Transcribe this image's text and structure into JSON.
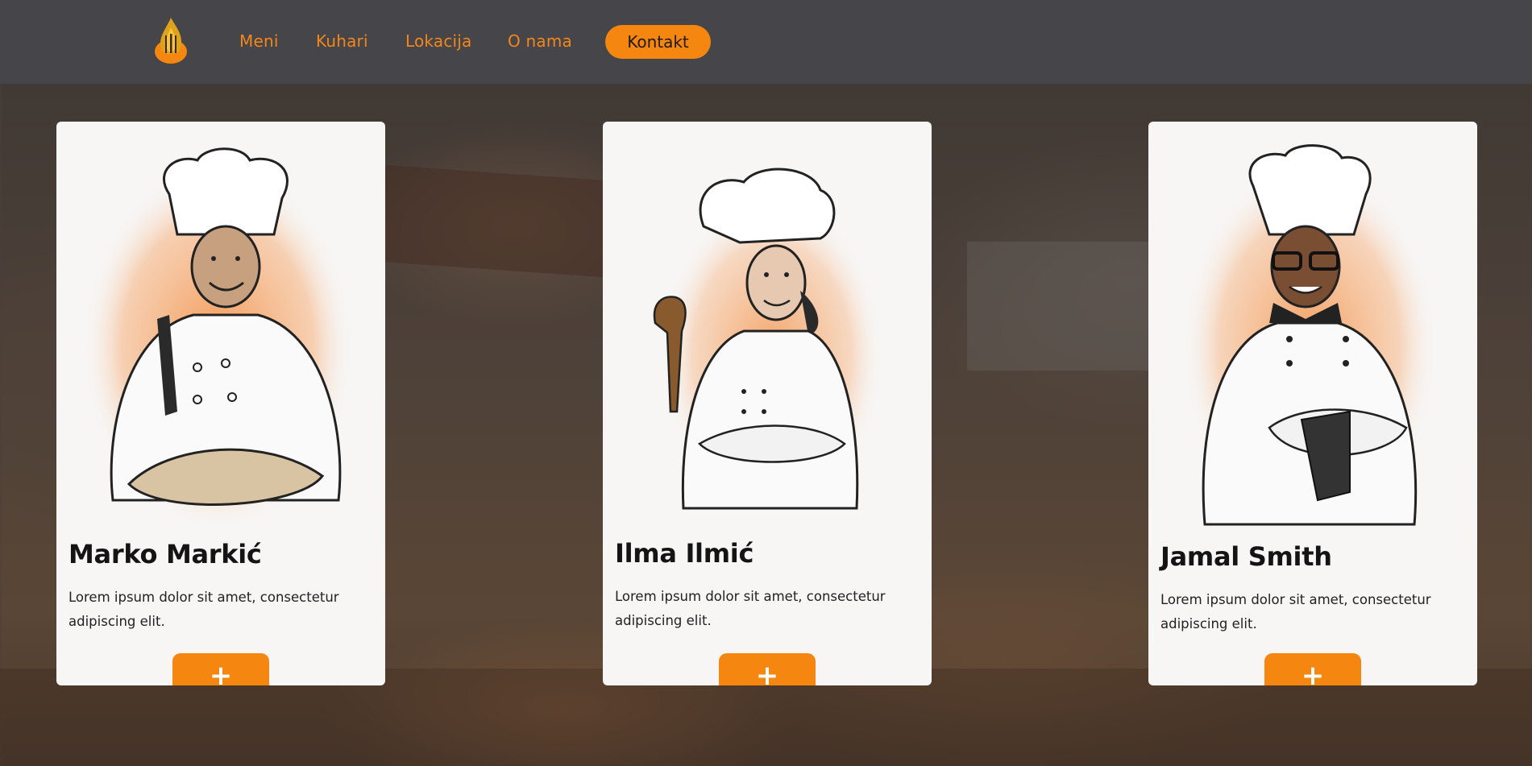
{
  "nav": {
    "logo_icon": "flame-fork-knife-icon",
    "links": [
      {
        "label": "Meni"
      },
      {
        "label": "Kuhari"
      },
      {
        "label": "Lokacija"
      },
      {
        "label": "O nama"
      }
    ],
    "cta_label": "Kontakt"
  },
  "colors": {
    "accent": "#f5860f",
    "nav_bg": "#464549",
    "card_bg": "#f7f6f5"
  },
  "chefs": [
    {
      "name": "Marko Markić",
      "description": "Lorem ipsum dolor sit amet, consectetur adipiscing elit.",
      "button_label": "+",
      "portrait_icon": "chef-with-knife-illustration"
    },
    {
      "name": "Ilma Ilmić",
      "description": "Lorem ipsum dolor sit amet, consectetur adipiscing elit.",
      "button_label": "+",
      "portrait_icon": "chef-with-spatula-illustration"
    },
    {
      "name": "Jamal Smith",
      "description": "Lorem ipsum dolor sit amet, consectetur adipiscing elit.",
      "button_label": "+",
      "portrait_icon": "chef-arms-crossed-illustration"
    }
  ]
}
